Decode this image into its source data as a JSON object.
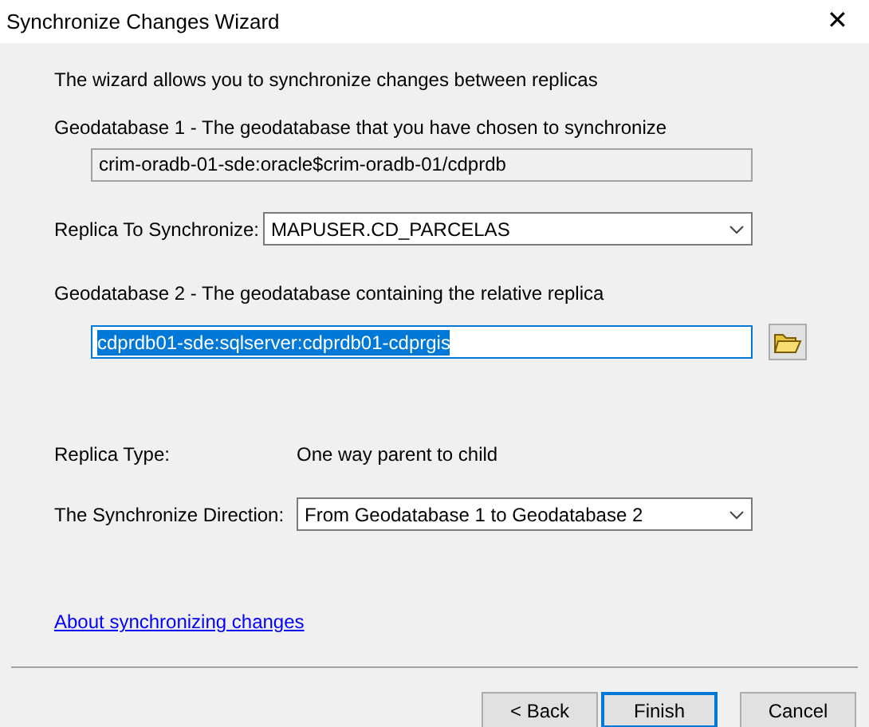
{
  "window": {
    "title": "Synchronize Changes Wizard",
    "close": "✕"
  },
  "intro": "The wizard allows you to synchronize changes between replicas",
  "geodatabase_1": {
    "label": "Geodatabase 1 - The geodatabase that you have chosen to synchronize",
    "value": "crim-oradb-01-sde:oracle$crim-oradb-01/cdprdb"
  },
  "replica": {
    "label": "Replica To Synchronize:",
    "value": "MAPUSER.CD_PARCELAS"
  },
  "geodatabase_2": {
    "label": "Geodatabase 2 - The geodatabase containing the relative replica",
    "value": "cdprdb01-sde:sqlserver:cdprdb01-cdprgis",
    "selected": true
  },
  "replica_type": {
    "label": "Replica Type:",
    "value": "One way parent to child"
  },
  "direction": {
    "label": "The Synchronize Direction:",
    "value": "From Geodatabase 1 to Geodatabase 2"
  },
  "help_link": "About synchronizing changes",
  "buttons": [
    {
      "label": "< Back",
      "focused": false
    },
    {
      "label": "Finish",
      "focused": true
    },
    {
      "label": "Cancel",
      "focused": false
    }
  ]
}
